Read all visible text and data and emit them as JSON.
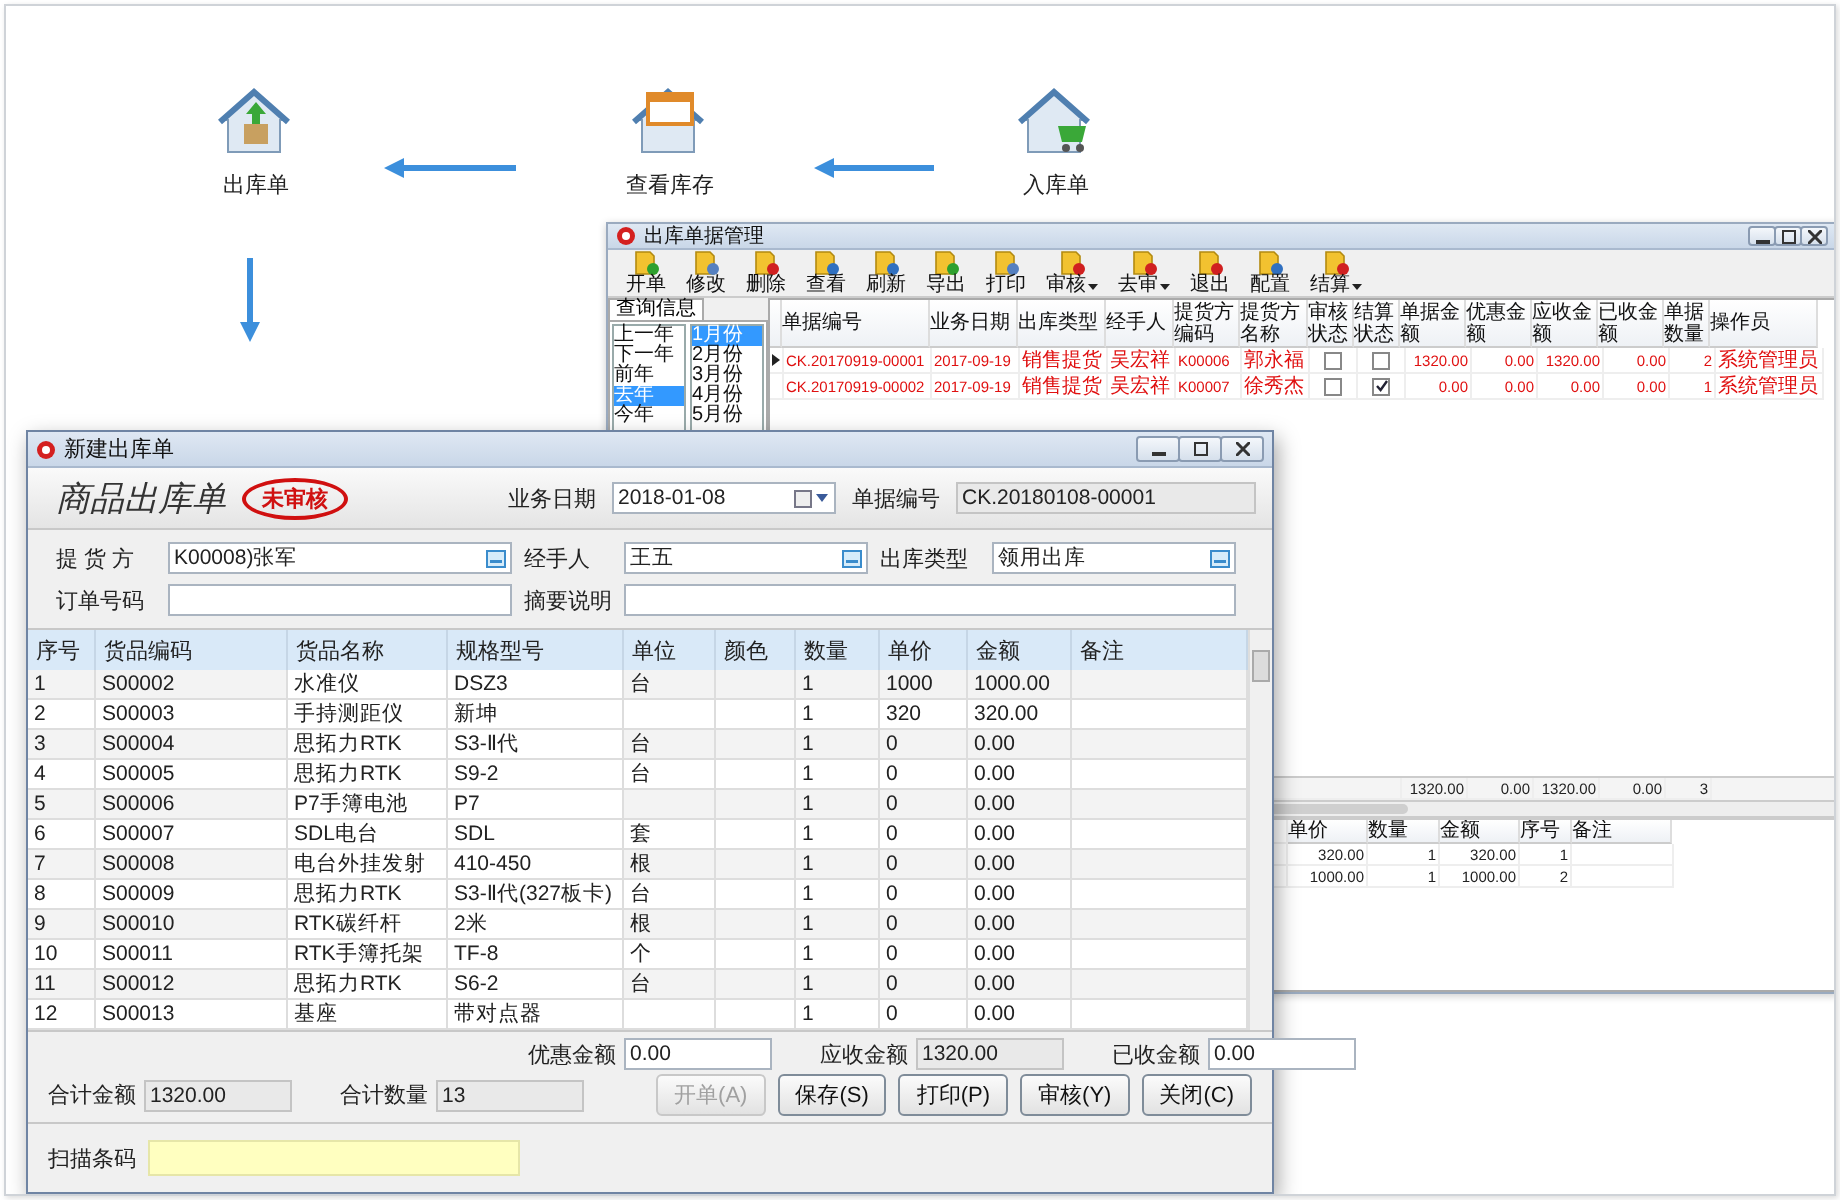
{
  "flow": {
    "nodes": [
      {
        "kind": "outbound",
        "label": "出库单"
      },
      {
        "kind": "stock",
        "label": "查看库存"
      },
      {
        "kind": "inbound",
        "label": "入库单"
      }
    ]
  },
  "manager_window": {
    "title": "出库单据管理",
    "toolbar": [
      {
        "label": "开单",
        "has_menu": false
      },
      {
        "label": "修改",
        "has_menu": false
      },
      {
        "label": "删除",
        "has_menu": false
      },
      {
        "label": "查看",
        "has_menu": false
      },
      {
        "label": "刷新",
        "has_menu": false
      },
      {
        "label": "导出",
        "has_menu": false
      },
      {
        "label": "打印",
        "has_menu": false
      },
      {
        "label": "审核",
        "has_menu": true
      },
      {
        "label": "去审",
        "has_menu": true
      },
      {
        "label": "退出",
        "has_menu": false
      },
      {
        "label": "配置",
        "has_menu": false
      },
      {
        "label": "结算",
        "has_menu": true
      }
    ],
    "query_tab": "查询信息",
    "years": [
      {
        "label": "上一年",
        "selected": false
      },
      {
        "label": "下一年",
        "selected": false
      },
      {
        "label": "前年",
        "selected": false
      },
      {
        "label": "去年",
        "selected": true
      },
      {
        "label": "今年",
        "selected": false
      }
    ],
    "months": [
      {
        "label": "1月份",
        "selected": true
      },
      {
        "label": "2月份",
        "selected": false
      },
      {
        "label": "3月份",
        "selected": false
      },
      {
        "label": "4月份",
        "selected": false
      },
      {
        "label": "5月份",
        "selected": false
      }
    ],
    "columns": [
      "单据编号",
      "业务日期",
      "出库类型",
      "经手人",
      "提货方编码",
      "提货方名称",
      "审核状态",
      "结算状态",
      "单据金额",
      "优惠金额",
      "应收金额",
      "已收金额",
      "单据数量",
      "操作员"
    ],
    "rows": [
      {
        "current": true,
        "code": "CK.20170919-00001",
        "date": "2017-09-19",
        "type": "销售提货",
        "handler": "吴宏祥",
        "party_code": "K00006",
        "party_name": "郭永福",
        "audited": false,
        "settled": false,
        "amount": "1320.00",
        "discount": "0.00",
        "receivable": "1320.00",
        "received": "0.00",
        "qty": "2",
        "operator": "系统管理员"
      },
      {
        "current": false,
        "code": "CK.20170919-00002",
        "date": "2017-09-19",
        "type": "销售提货",
        "handler": "吴宏祥",
        "party_code": "K00007",
        "party_name": "徐秀杰",
        "audited": false,
        "settled": true,
        "amount": "0.00",
        "discount": "0.00",
        "receivable": "0.00",
        "received": "0.00",
        "qty": "1",
        "operator": "系统管理员"
      }
    ],
    "totals": [
      "1320.00",
      "0.00",
      "1320.00",
      "0.00",
      "3"
    ],
    "detail": {
      "columns": [
        "单价",
        "数量",
        "金额",
        "序号",
        "备注"
      ],
      "rows": [
        {
          "price": "320.00",
          "qty": "1",
          "amount": "320.00",
          "index": "1"
        },
        {
          "price": "1000.00",
          "qty": "1",
          "amount": "1000.00",
          "index": "2"
        }
      ]
    }
  },
  "dialog": {
    "title": "新建出库单",
    "heading": "商品出库单",
    "stamp": "未审核",
    "date": {
      "label": "业务日期",
      "value": "2018-01-08"
    },
    "number": {
      "label": "单据编号",
      "value": "CK.20180108-00001"
    },
    "fields": [
      {
        "label": "提 货 方",
        "value": "K00008)张军",
        "lookup": true
      },
      {
        "label": "经手人",
        "value": "王五",
        "lookup": true
      },
      {
        "label": "出库类型",
        "value": "领用出库",
        "lookup": true
      },
      {
        "label": "订单号码",
        "lookup": false
      },
      {
        "label": "摘要说明",
        "lookup": false
      }
    ],
    "columns": [
      "序号",
      "货品编码",
      "货品名称",
      "规格型号",
      "单位",
      "颜色",
      "数量",
      "单价",
      "金额",
      "备注"
    ],
    "rows": [
      {
        "index": "1",
        "code": "S00002",
        "name": "水准仪",
        "spec": "DSZ3",
        "unit": "台",
        "qty": "1",
        "price": "1000",
        "amount": "1000.00"
      },
      {
        "index": "2",
        "code": "S00003",
        "name": "手持测距仪",
        "spec": "新坤",
        "qty": "1",
        "price": "320",
        "amount": "320.00"
      },
      {
        "index": "3",
        "code": "S00004",
        "name": "思拓力RTK",
        "spec": "S3-Ⅱ代",
        "unit": "台",
        "qty": "1",
        "price": "0",
        "amount": "0.00"
      },
      {
        "index": "4",
        "code": "S00005",
        "name": "思拓力RTK",
        "spec": "S9-2",
        "unit": "台",
        "qty": "1",
        "price": "0",
        "amount": "0.00"
      },
      {
        "index": "5",
        "code": "S00006",
        "name": "P7手簿电池",
        "spec": "P7",
        "qty": "1",
        "price": "0",
        "amount": "0.00"
      },
      {
        "index": "6",
        "code": "S00007",
        "name": "SDL电台",
        "spec": "SDL",
        "unit": "套",
        "qty": "1",
        "price": "0",
        "amount": "0.00"
      },
      {
        "index": "7",
        "code": "S00008",
        "name": "电台外挂发射",
        "spec": "410-450",
        "unit": "根",
        "qty": "1",
        "price": "0",
        "amount": "0.00"
      },
      {
        "index": "8",
        "code": "S00009",
        "name": "思拓力RTK",
        "spec": "S3-Ⅱ代(327板卡)",
        "unit": "台",
        "qty": "1",
        "price": "0",
        "amount": "0.00"
      },
      {
        "index": "9",
        "code": "S00010",
        "name": "RTK碳纤杆",
        "spec": "2米",
        "unit": "根",
        "qty": "1",
        "price": "0",
        "amount": "0.00"
      },
      {
        "index": "10",
        "code": "S00011",
        "name": "RTK手簿托架",
        "spec": "TF-8",
        "unit": "个",
        "qty": "1",
        "price": "0",
        "amount": "0.00"
      },
      {
        "index": "11",
        "code": "S00012",
        "name": "思拓力RTK",
        "spec": "S6-2",
        "unit": "台",
        "qty": "1",
        "price": "0",
        "amount": "0.00"
      },
      {
        "index": "12",
        "code": "S00013",
        "name": "基座",
        "spec": "带对点器",
        "qty": "1",
        "price": "0",
        "amount": "0.00"
      }
    ],
    "summary": [
      {
        "label": "优惠金额",
        "value": "0.00",
        "readonly": false
      },
      {
        "label": "应收金额",
        "value": "1320.00",
        "readonly": true
      },
      {
        "label": "已收金额",
        "value": "0.00",
        "readonly": false
      }
    ],
    "totals": [
      {
        "label": "合计金额",
        "value": "1320.00"
      },
      {
        "label": "合计数量",
        "value": "13"
      }
    ],
    "buttons": [
      {
        "label": "开单(A)",
        "disabled": true
      },
      {
        "label": "保存(S)",
        "disabled": false
      },
      {
        "label": "打印(P)",
        "disabled": false
      },
      {
        "label": "审核(Y)",
        "disabled": false
      },
      {
        "label": "关闭(C)",
        "disabled": false
      }
    ],
    "scan": {
      "label": "扫描条码"
    }
  }
}
